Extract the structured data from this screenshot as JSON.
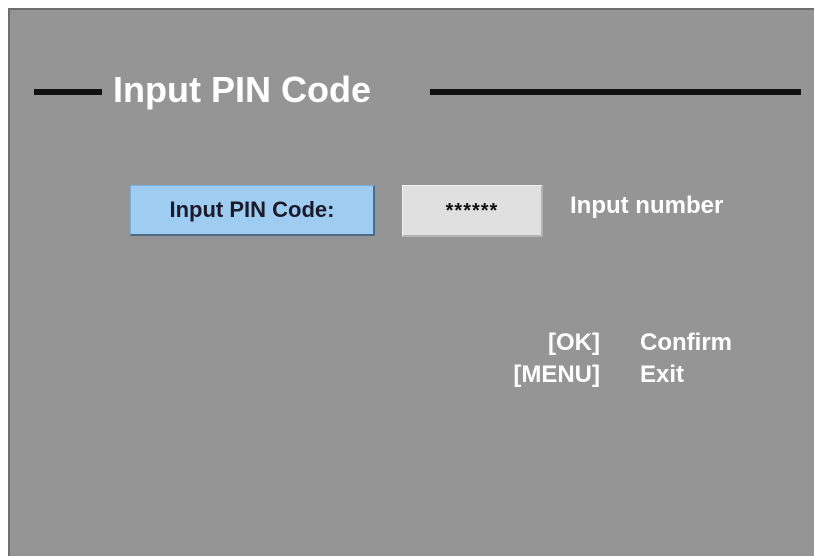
{
  "title": "Input PIN Code",
  "pin": {
    "label": "Input PIN Code:",
    "value": "******",
    "hint": "Input number"
  },
  "help": [
    {
      "key": "[OK]",
      "action": "Confirm"
    },
    {
      "key": "[MENU]",
      "action": "Exit"
    }
  ],
  "colors": {
    "background": "#959595",
    "label_highlight": "#9fcdf2",
    "field": "#e0e0e0",
    "text": "#ffffff"
  }
}
